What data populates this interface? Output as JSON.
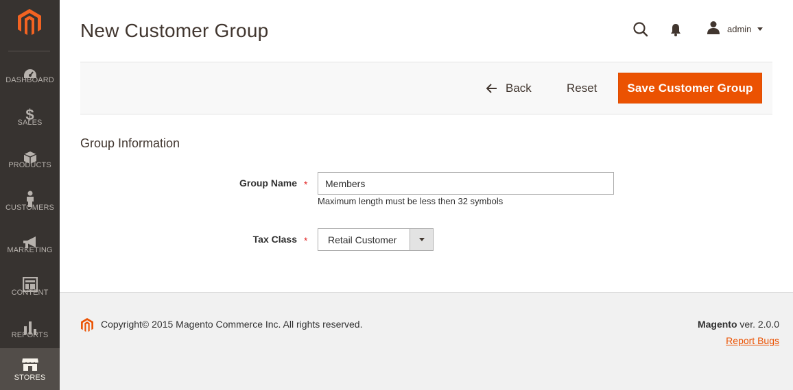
{
  "sidebar": {
    "logo": "magento-logo",
    "items": [
      {
        "label": "DASHBOARD",
        "icon": "speedometer-icon"
      },
      {
        "label": "SALES",
        "icon": "dollar-icon"
      },
      {
        "label": "PRODUCTS",
        "icon": "box-icon"
      },
      {
        "label": "CUSTOMERS",
        "icon": "person-icon"
      },
      {
        "label": "MARKETING",
        "icon": "megaphone-icon"
      },
      {
        "label": "CONTENT",
        "icon": "layout-icon"
      },
      {
        "label": "REPORTS",
        "icon": "bar-chart-icon"
      },
      {
        "label": "STORES",
        "icon": "storefront-icon",
        "active": true
      }
    ]
  },
  "header": {
    "title": "New Customer Group",
    "user": "admin"
  },
  "actions": {
    "back_label": "Back",
    "reset_label": "Reset",
    "save_label": "Save Customer Group"
  },
  "form": {
    "section_title": "Group Information",
    "group_name": {
      "label": "Group Name",
      "required_mark": "*",
      "value": "Members",
      "note": "Maximum length must be less then 32 symbols"
    },
    "tax_class": {
      "label": "Tax Class",
      "required_mark": "*",
      "value": "Retail Customer"
    }
  },
  "footer": {
    "copyright": "Copyright© 2015 Magento Commerce Inc. All rights reserved.",
    "version_brand": "Magento",
    "version_text": " ver. 2.0.0",
    "report_bugs": "Report Bugs"
  },
  "colors": {
    "accent": "#eb5202",
    "sidebar_bg": "#373330",
    "sidebar_active": "#524d49"
  }
}
